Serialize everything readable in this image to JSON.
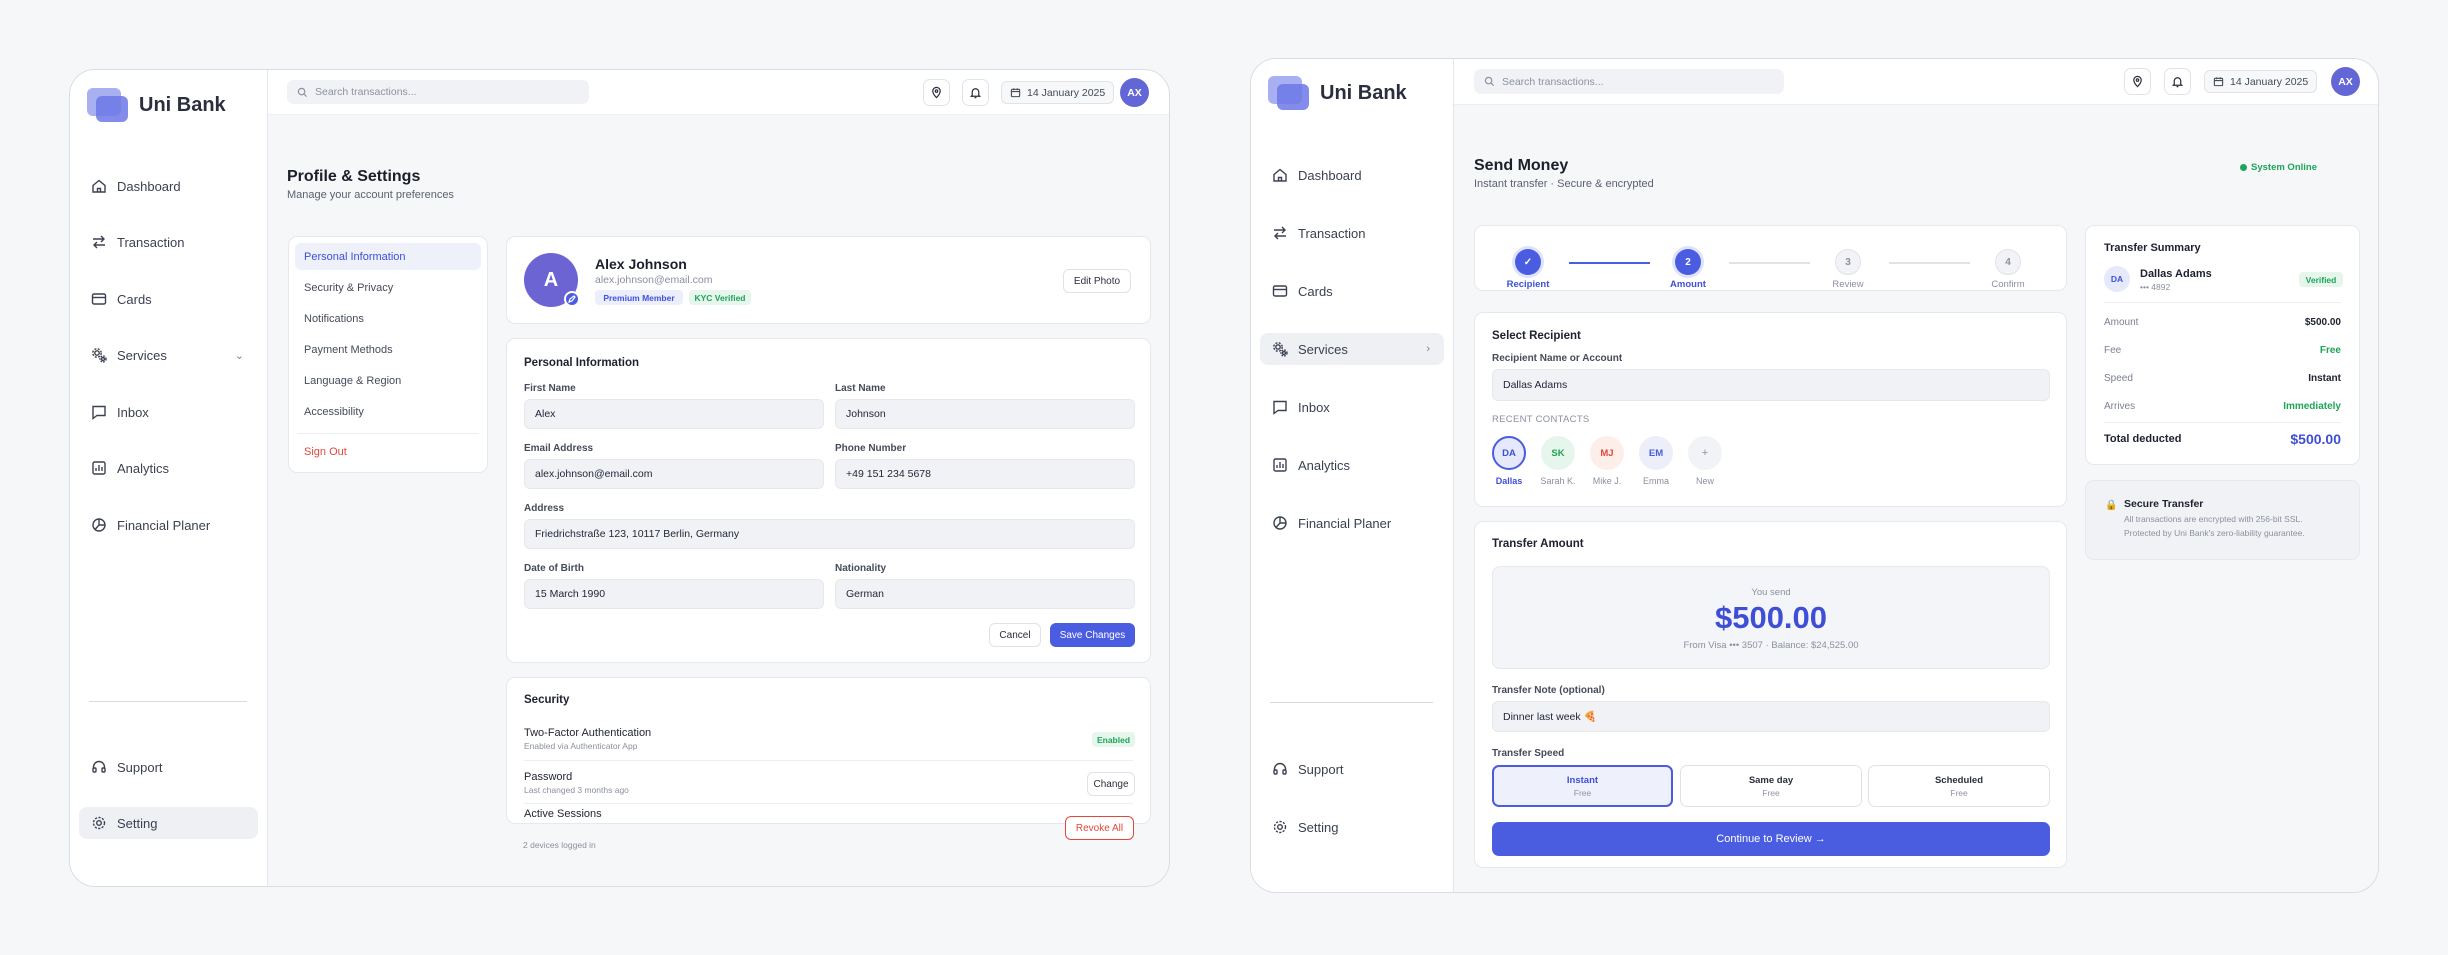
{
  "brand": {
    "name": "Uni Bank"
  },
  "nav": {
    "dashboard": "Dashboard",
    "transaction": "Transaction",
    "cards": "Cards",
    "services": "Services",
    "inbox": "Inbox",
    "analytics": "Analytics",
    "financial": "Financial Planer",
    "support": "Support",
    "setting": "Setting"
  },
  "topbar": {
    "search_placeholder": "Search transactions...",
    "date": "14 January 2025",
    "avatar": "AX"
  },
  "profile": {
    "title": "Profile & Settings",
    "subtitle": "Manage your account preferences",
    "menu": [
      "Personal Information",
      "Security & Privacy",
      "Notifications",
      "Payment Methods",
      "Language & Region",
      "Accessibility"
    ],
    "sign_out": "Sign Out",
    "user": {
      "initial": "A",
      "name": "Alex Johnson",
      "email": "alex.johnson@email.com",
      "badge_member": "Premium Member",
      "badge_kyc": "KYC Verified",
      "edit_photo": "Edit Photo"
    },
    "personal": {
      "title": "Personal Information",
      "first_name_label": "First Name",
      "first_name": "Alex",
      "last_name_label": "Last Name",
      "last_name": "Johnson",
      "email_label": "Email Address",
      "email": "alex.johnson@email.com",
      "phone_label": "Phone Number",
      "phone": "+49 151 234 5678",
      "address_label": "Address",
      "address": "Friedrichstraße 123, 10117 Berlin, Germany",
      "dob_label": "Date of Birth",
      "dob": "15 March 1990",
      "nationality_label": "Nationality",
      "nationality": "German",
      "cancel": "Cancel",
      "save": "Save Changes"
    },
    "security": {
      "title": "Security",
      "twofa_title": "Two-Factor Authentication",
      "twofa_sub": "Enabled via Authenticator App",
      "twofa_status": "Enabled",
      "pw_title": "Password",
      "pw_sub": "Last changed 3 months ago",
      "pw_btn": "Change",
      "sessions_title": "Active Sessions",
      "sessions_sub": "2 devices logged in",
      "sessions_btn": "Revoke All"
    }
  },
  "send": {
    "title": "Send Money",
    "subtitle": "Instant transfer · Secure & encrypted",
    "status": "System Online",
    "steps": [
      {
        "n": "✓",
        "label": "Recipient"
      },
      {
        "n": "2",
        "label": "Amount"
      },
      {
        "n": "3",
        "label": "Review"
      },
      {
        "n": "4",
        "label": "Confirm"
      }
    ],
    "recipient": {
      "title": "Select Recipient",
      "field_label": "Recipient Name or Account",
      "value": "Dallas Adams",
      "recent_label": "RECENT CONTACTS",
      "contacts": [
        {
          "initials": "DA",
          "name": "Dallas"
        },
        {
          "initials": "SK",
          "name": "Sarah K."
        },
        {
          "initials": "MJ",
          "name": "Mike J."
        },
        {
          "initials": "EM",
          "name": "Emma"
        },
        {
          "initials": "+",
          "name": "New"
        }
      ]
    },
    "amount": {
      "title": "Transfer Amount",
      "you_send": "You send",
      "value": "$500.00",
      "from": "From Visa ••• 3507 · Balance: $24,525.00",
      "note_label": "Transfer Note (optional)",
      "note": "Dinner last week 🍕",
      "speed_label": "Transfer Speed",
      "speeds": [
        {
          "name": "Instant",
          "fee": "Free"
        },
        {
          "name": "Same day",
          "fee": "Free"
        },
        {
          "name": "Scheduled",
          "fee": "Free"
        }
      ],
      "continue": "Continue to Review →"
    },
    "summary": {
      "title": "Transfer Summary",
      "initials": "DA",
      "name": "Dallas Adams",
      "acct": "••• 4892",
      "verified": "Verified",
      "rows": [
        {
          "k": "Amount",
          "v": "$500.00"
        },
        {
          "k": "Fee",
          "v": "Free"
        },
        {
          "k": "Speed",
          "v": "Instant"
        },
        {
          "k": "Arrives",
          "v": "Immediately"
        }
      ],
      "total_label": "Total deducted",
      "total": "$500.00"
    },
    "secure": {
      "title": "Secure Transfer",
      "text1": "All transactions are encrypted with 256-bit SSL.",
      "text2": "Protected by Uni Bank's zero-liability guarantee."
    }
  },
  "colors": {
    "accent": "#4a5ce0",
    "success": "#1fa45a",
    "danger": "#e0483b"
  }
}
